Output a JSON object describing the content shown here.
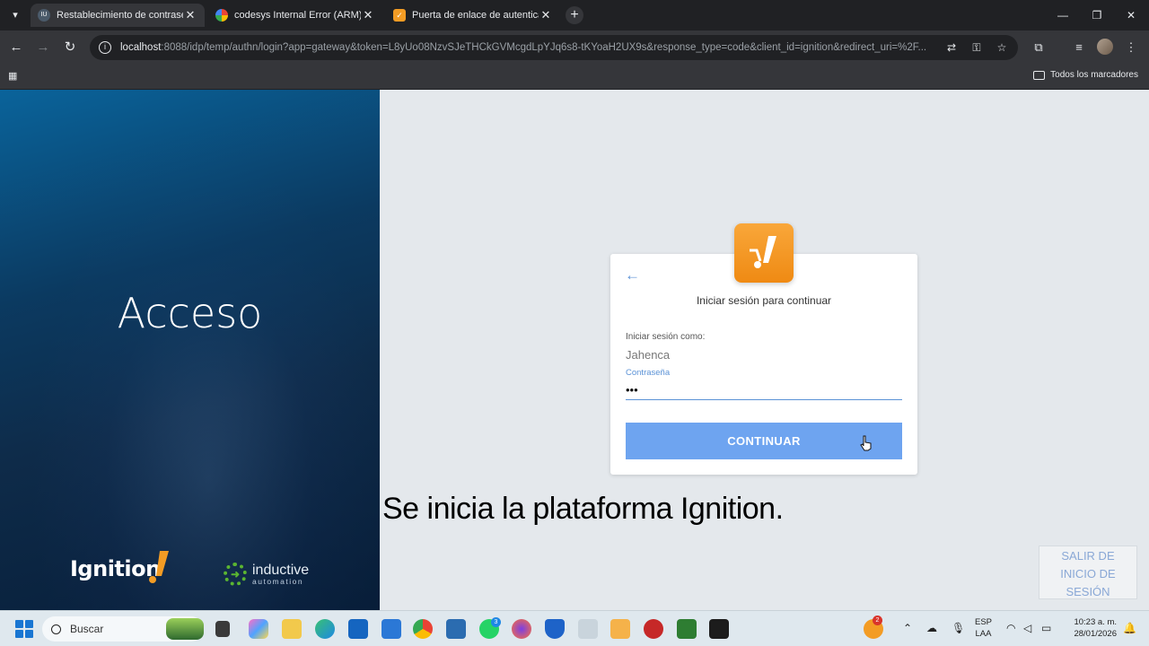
{
  "browser": {
    "tabs": [
      {
        "title": "Restablecimiento de contraseña",
        "favicon": "ignition-favicon",
        "active": true
      },
      {
        "title": "codesys Internal Error (ARM) U",
        "favicon": "google-favicon",
        "active": false
      },
      {
        "title": "Puerta de enlace de autenticación",
        "favicon": "ignition-favicon",
        "active": false
      }
    ],
    "url_host": "localhost",
    "url_rest": ":8088/idp/temp/authn/login?app=gateway&token=L8yUo08NzvSJeTHCkGVMcgdLpYJq6s8-tKYoaH2UX9s&response_type=code&client_id=ignition&redirect_uri=%2F...",
    "bookmarks_all": "Todos los marcadores"
  },
  "left_panel": {
    "heading": "Acceso",
    "logo_text": "Ignition",
    "ia_big": "inductive",
    "ia_small": "automation"
  },
  "login": {
    "title": "Iniciar sesión para continuar",
    "user_label": "Iniciar sesión como:",
    "user_value": "Jahenca",
    "password_label": "Contraseña",
    "password_value": "•••",
    "continue_label": "CONTINUAR"
  },
  "caption": "Se inicia la plataforma Ignition.",
  "logout": {
    "line1": "SALIR DE",
    "line2": "INICIO DE",
    "line3": "SESIÓN"
  },
  "taskbar": {
    "search_placeholder": "Buscar",
    "lang_line1": "ESP",
    "lang_line2": "LAA",
    "time": "10:23 a. m.",
    "date": "28/01/2026",
    "whatsapp_badge": "3",
    "notif_badge": "2"
  },
  "colors": {
    "accent": "#6ea4f0",
    "link": "#5b92d6",
    "ignition_orange": "#f39c24",
    "ia_green": "#5bb531"
  }
}
